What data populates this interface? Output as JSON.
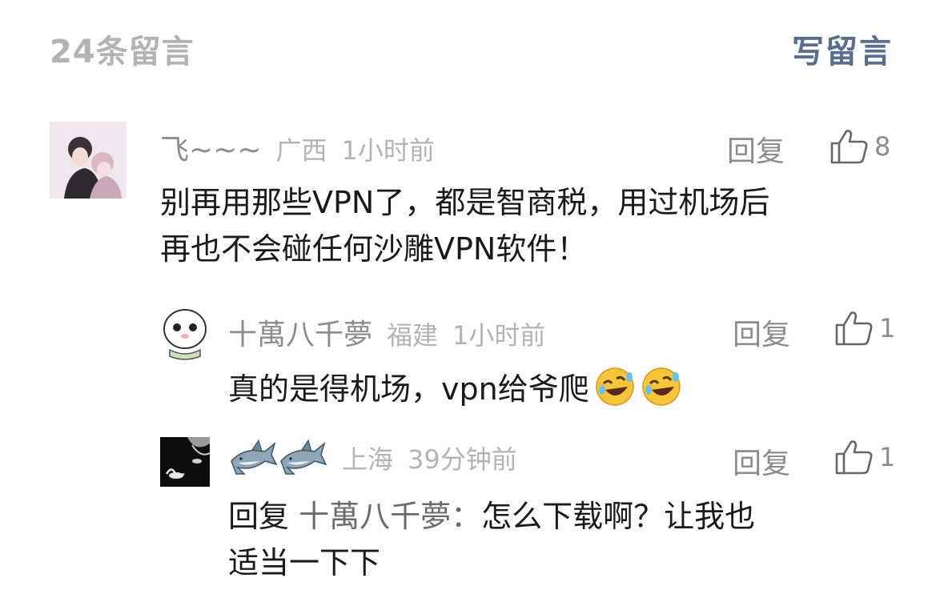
{
  "header": {
    "count_label": "24条留言",
    "write_label": "写留言"
  },
  "comments": [
    {
      "nickname": "飞~~~",
      "location": "广西",
      "time": "1小时前",
      "reply_label": "回复",
      "likes": "8",
      "lines": [
        "别再用那些VPN了，都是智商税，用过机场后",
        "再也不会碰任何沙雕VPN软件！"
      ]
    },
    {
      "nickname": "十萬八千夢",
      "location": "福建",
      "time": "1小时前",
      "reply_label": "回复",
      "likes": "1",
      "text": "真的是得机场，vpn给爷爬"
    },
    {
      "location": "上海",
      "time": "39分钟前",
      "reply_label": "回复",
      "likes": "1",
      "reply_prefix": "回复",
      "reply_to": "十萬八千夢：",
      "line1_rest": "怎么下载啊？让我也",
      "line2": "适当一下下"
    }
  ]
}
